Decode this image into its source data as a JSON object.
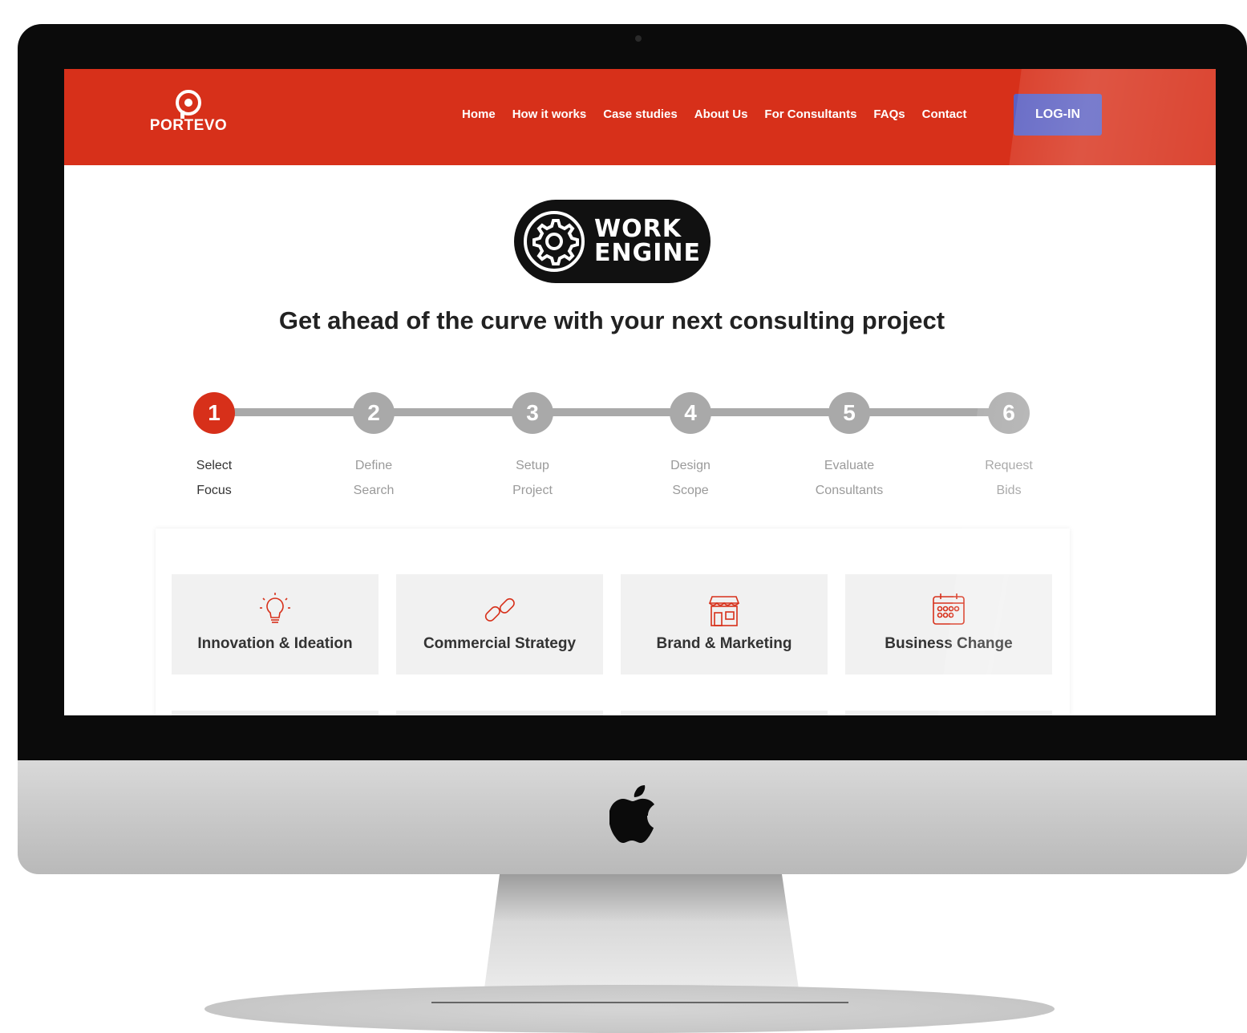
{
  "brand": {
    "name": "PORTEVO"
  },
  "nav": {
    "items": [
      "Home",
      "How it works",
      "Case studies",
      "About Us",
      "For Consultants",
      "FAQs",
      "Contact"
    ],
    "login_label": "LOG-IN"
  },
  "badge": {
    "line1": "WORK",
    "line2": "ENGINE"
  },
  "headline": "Get ahead of the curve with your next consulting project",
  "steps": [
    {
      "number": "1",
      "line1": "Select",
      "line2": "Focus",
      "active": true
    },
    {
      "number": "2",
      "line1": "Define",
      "line2": "Search",
      "active": false
    },
    {
      "number": "3",
      "line1": "Setup",
      "line2": "Project",
      "active": false
    },
    {
      "number": "4",
      "line1": "Design",
      "line2": "Scope",
      "active": false
    },
    {
      "number": "5",
      "line1": "Evaluate",
      "line2": "Consultants",
      "active": false
    },
    {
      "number": "6",
      "line1": "Request",
      "line2": "Bids",
      "active": false
    }
  ],
  "focus_cards": [
    {
      "label": "Innovation & Ideation",
      "icon": "lightbulb-icon"
    },
    {
      "label": "Commercial Strategy",
      "icon": "chain-link-icon"
    },
    {
      "label": "Brand & Marketing",
      "icon": "storefront-icon"
    },
    {
      "label": "Business Change",
      "icon": "calendar-icon"
    }
  ],
  "colors": {
    "brand_red": "#d7301a",
    "login_blue": "#5c60c2",
    "step_inactive": "#a9a9a9"
  }
}
